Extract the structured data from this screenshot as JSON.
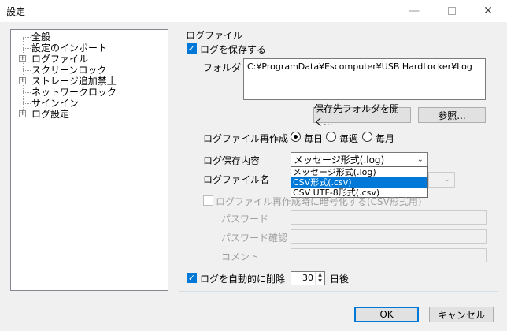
{
  "window": {
    "title": "設定"
  },
  "tree": {
    "items": [
      {
        "label": "全般",
        "expandable": false
      },
      {
        "label": "設定のインポート",
        "expandable": false
      },
      {
        "label": "ログファイル",
        "expandable": true
      },
      {
        "label": "スクリーンロック",
        "expandable": false
      },
      {
        "label": "ストレージ追加禁止",
        "expandable": true
      },
      {
        "label": "ネットワークロック",
        "expandable": false
      },
      {
        "label": "サインイン",
        "expandable": false
      },
      {
        "label": "ログ設定",
        "expandable": true
      }
    ]
  },
  "logfile": {
    "group_title": "ログファイル",
    "save_log_label": "ログを保存する",
    "folder_label": "フォルダ",
    "folder_value": "C:¥ProgramData¥Escomputer¥USB HardLocker¥Log",
    "open_folder_button": "保存先フォルダを開く...",
    "browse_button": "参照...",
    "recreate_label": "ログファイル再作成",
    "recreate_options": [
      "毎日",
      "毎週",
      "毎月"
    ],
    "recreate_selected": "毎日",
    "content_label": "ログ保存内容",
    "content_value": "メッセージ形式(.log)",
    "content_options": [
      "メッセージ形式(.log)",
      "CSV形式(.csv)",
      "CSV UTF-8形式(.csv)"
    ],
    "content_highlighted": "CSV形式(.csv)",
    "filename_label": "ログファイル名",
    "encrypt_label": "ログファイル再作成時に暗号化する(CSV形式用)",
    "password_label": "パスワード",
    "password_confirm_label": "パスワード確認",
    "comment_label": "コメント",
    "auto_delete_label": "ログを自動的に削除",
    "auto_delete_days": "30",
    "days_suffix": "日後"
  },
  "footer": {
    "ok_button": "OK",
    "cancel_button": "キャンセル"
  },
  "colors": {
    "accent": "#0078d7",
    "background": "#f0f0f0"
  }
}
